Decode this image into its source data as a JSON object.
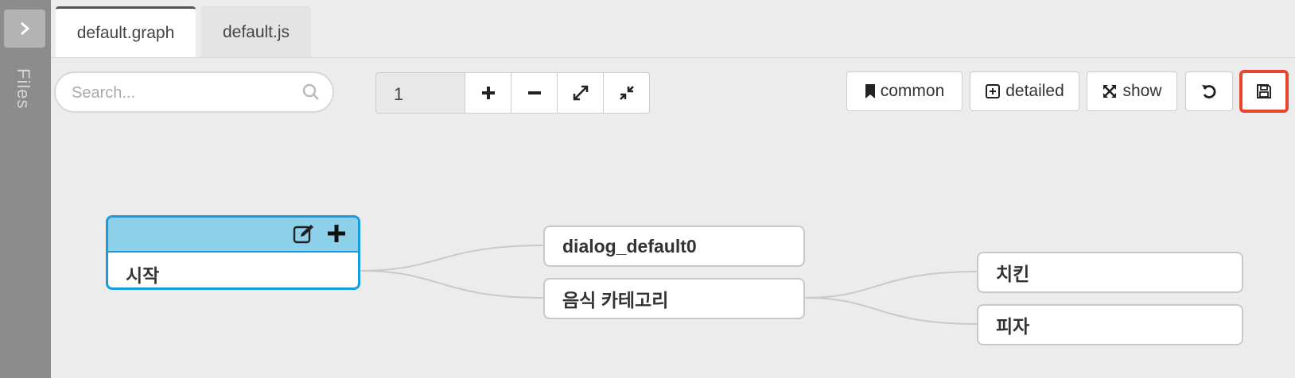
{
  "sidebar": {
    "label": "Files",
    "toggle_icon": "chevron-right-icon"
  },
  "tabs": [
    {
      "label": "default.graph",
      "active": true
    },
    {
      "label": "default.js",
      "active": false
    }
  ],
  "search": {
    "placeholder": "Search...",
    "value": ""
  },
  "zoom": {
    "value": "1"
  },
  "toolbar": {
    "common_label": "common",
    "detailed_label": "detailed",
    "show_label": "show"
  },
  "nodes": {
    "start": "시작",
    "dialog": "dialog_default0",
    "food_category": "음식 카테고리",
    "chicken": "치킨",
    "pizza": "피자"
  },
  "colors": {
    "selected_border": "#1a9be0",
    "selected_header": "#8dd0ea",
    "save_highlight": "#e8452b"
  }
}
